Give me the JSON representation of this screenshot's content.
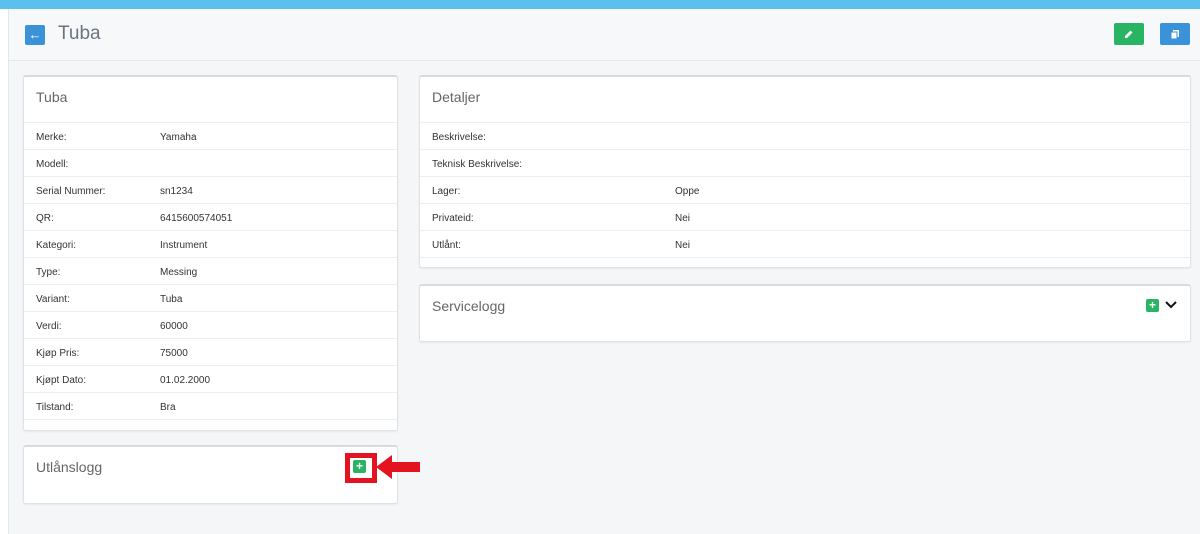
{
  "header": {
    "title": "Tuba"
  },
  "left_card": {
    "title": "Tuba",
    "rows": [
      {
        "label": "Merke:",
        "value": "Yamaha"
      },
      {
        "label": "Modell:",
        "value": ""
      },
      {
        "label": "Serial Nummer:",
        "value": "sn1234"
      },
      {
        "label": "QR:",
        "value": "6415600574051"
      },
      {
        "label": "Kategori:",
        "value": "Instrument"
      },
      {
        "label": "Type:",
        "value": "Messing"
      },
      {
        "label": "Variant:",
        "value": "Tuba"
      },
      {
        "label": "Verdi:",
        "value": "60000"
      },
      {
        "label": "Kjøp Pris:",
        "value": "75000"
      },
      {
        "label": "Kjøpt Dato:",
        "value": "01.02.2000"
      },
      {
        "label": "Tilstand:",
        "value": "Bra"
      }
    ]
  },
  "details_card": {
    "title": "Detaljer",
    "rows": [
      {
        "label": "Beskrivelse:",
        "value": ""
      },
      {
        "label": "Teknisk Beskrivelse:",
        "value": ""
      },
      {
        "label": "Lager:",
        "value": "Oppe"
      },
      {
        "label": "Privateid:",
        "value": "Nei"
      },
      {
        "label": "Utlånt:",
        "value": "Nei"
      }
    ]
  },
  "service_card": {
    "title": "Servicelogg",
    "add_label": "+"
  },
  "loan_card": {
    "title": "Utlånslogg",
    "add_label": "+"
  },
  "icons": {
    "back": "arrow-left-icon",
    "edit": "pencil-icon",
    "copy": "copy-icon",
    "add": "plus-icon",
    "expand": "chevron-down-icon"
  },
  "colors": {
    "top_bar": "#5bc0eb",
    "primary": "#3a92d8",
    "success": "#28b463",
    "annotation": "#e3141f"
  }
}
